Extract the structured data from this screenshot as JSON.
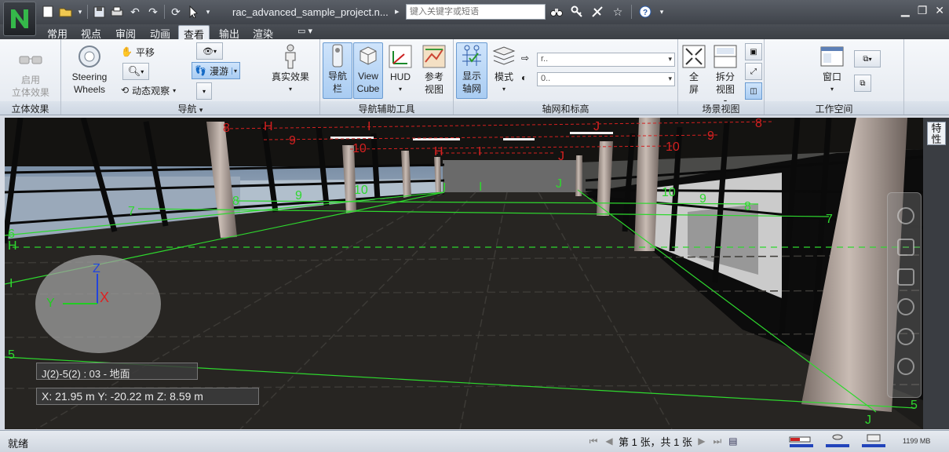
{
  "titlebar": {
    "doc_title": "rac_advanced_sample_project.n...",
    "search_placeholder": "键入关键字或短语",
    "qat_icons": [
      "new-icon",
      "open-icon",
      "save-icon",
      "print-icon",
      "undo-icon",
      "redo-icon",
      "refresh-icon",
      "select-icon"
    ],
    "right_icons": [
      "binoculars-icon",
      "key-icon",
      "communication-center-icon",
      "favorites-icon",
      "help-icon"
    ],
    "window_controls": [
      "minimize-icon",
      "restore-icon",
      "close-icon"
    ]
  },
  "tabs": [
    "常用",
    "视点",
    "审阅",
    "动画",
    "查看",
    "输出",
    "渲染"
  ],
  "active_tab": "查看",
  "ribbon": {
    "stereo": {
      "button": "启用\n立体效果",
      "panel": "立体效果"
    },
    "navigate": {
      "steering": "Steering\nWheels",
      "pan": "平移",
      "orbit": "动态观察",
      "walk": "漫游",
      "realism": "真实效果",
      "panel": "导航"
    },
    "nav_aids": {
      "nav_bar": "导航\n栏",
      "viewcube": "View\nCube",
      "hud": "HUD",
      "ref_view": "参考\n视图",
      "panel": "导航辅助工具"
    },
    "grids": {
      "show_grid": "显示\n轴网",
      "mode": "模式",
      "combo1": "r..",
      "combo2": "0..",
      "panel": "轴网和标高"
    },
    "scene": {
      "fullscreen": "全\n屏",
      "split": "拆分\n视图",
      "panel": "场景视图"
    },
    "workspace": {
      "window": "窗口",
      "panel": "工作空间"
    }
  },
  "viewport": {
    "properties_tab": "特\n性",
    "location": "J(2)-5(2) : 03 - 地面",
    "coordinates": "X: 21.95 m  Y: -20.22 m  Z: 8.59 m",
    "axis_labels": {
      "z": "Z",
      "y": "Y",
      "x": "X"
    },
    "grid_labels_red": [
      "8",
      "H",
      "I",
      "J",
      "8",
      "9",
      "10",
      "9",
      "H",
      "I",
      "J",
      "10"
    ],
    "grid_labels_green": [
      "9",
      "10",
      "I",
      "I",
      "J",
      "10",
      "9",
      "8",
      "7",
      "7",
      "8",
      "6",
      "H",
      "I",
      "5",
      "5",
      "J"
    ]
  },
  "statusbar": {
    "status": "就绪",
    "page_info": "第 1 张，共 1 张",
    "memory": "1199 MB"
  },
  "colors": {
    "grid_red": "#d42020",
    "grid_green": "#2ed82e",
    "ribbon_pressed": "#a9ccf2"
  }
}
